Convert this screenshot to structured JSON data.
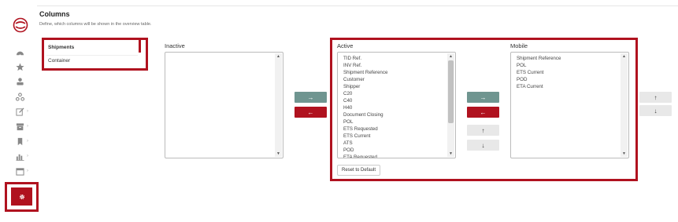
{
  "header": {
    "title": "Columns",
    "subtitle": "Define, which columns will be shown in the overview table."
  },
  "sidebar": {
    "items": [
      {
        "icon": "dashboard-icon"
      },
      {
        "icon": "star-icon"
      },
      {
        "icon": "user-badge-icon"
      },
      {
        "icon": "network-icon"
      },
      {
        "icon": "edit-icon",
        "chevron": "›"
      },
      {
        "icon": "archive-icon",
        "chevron": "›"
      },
      {
        "icon": "bookmark-icon",
        "chevron": "›"
      },
      {
        "icon": "bar-chart-icon",
        "chevron": "›"
      },
      {
        "icon": "calendar-icon",
        "chevron": "›"
      }
    ],
    "settings_icon": "gear-icon"
  },
  "tabs": {
    "shipments": "Shipments",
    "container": "Container"
  },
  "columns": {
    "inactive_label": "Inactive",
    "active_label": "Active",
    "mobile_label": "Mobile",
    "inactive_items": [],
    "active_items": [
      "TID Ref.",
      "INV Ref.",
      "Shipment Reference",
      "Customer",
      "Shipper",
      "C20",
      "C40",
      "H40",
      "Document Closing",
      "POL",
      "ETS Requested",
      "ETS Current",
      "ATS",
      "POD",
      "ETA Requested"
    ],
    "mobile_items": [
      "Shipment Reference",
      "POL",
      "ETS Current",
      "POD",
      "ETA Current"
    ]
  },
  "buttons": {
    "move_right": "→",
    "move_left": "←",
    "move_up": "↑",
    "move_down": "↓",
    "reset": "Reset to Default"
  },
  "colors": {
    "accent": "#b0121f",
    "teal": "#6f9590"
  }
}
